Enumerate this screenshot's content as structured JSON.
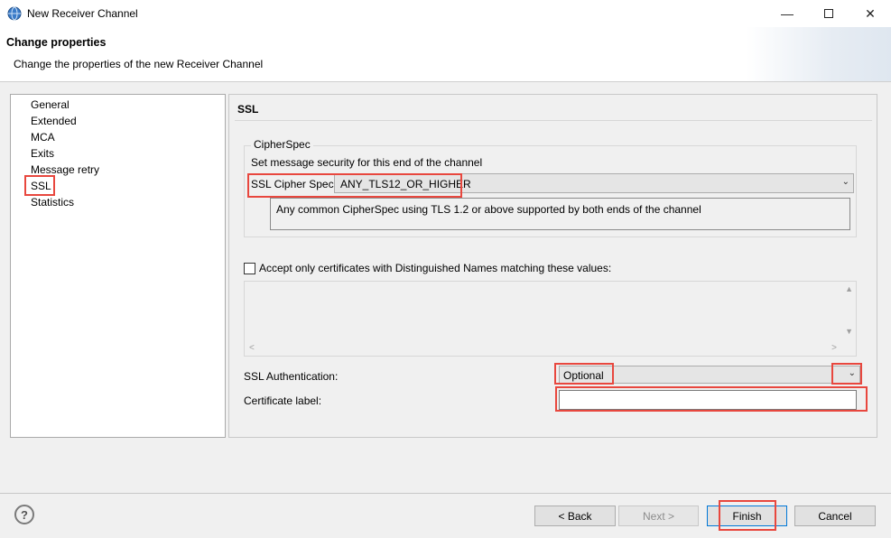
{
  "window": {
    "title": "New Receiver Channel",
    "minimize_icon": "minimize-icon",
    "maximize_icon": "maximize-icon",
    "close_icon": "close-icon"
  },
  "header": {
    "title": "Change properties",
    "description": "Change the properties of the new Receiver Channel"
  },
  "nav": {
    "items": [
      {
        "label": "General"
      },
      {
        "label": "Extended"
      },
      {
        "label": "MCA"
      },
      {
        "label": "Exits"
      },
      {
        "label": "Message retry"
      },
      {
        "label": "SSL"
      },
      {
        "label": "Statistics"
      }
    ],
    "selected": "SSL"
  },
  "panel": {
    "title": "SSL",
    "cipherspec": {
      "legend": "CipherSpec",
      "description": "Set message security for this end of the channel",
      "label": "SSL Cipher Spec:",
      "value": "ANY_TLS12_OR_HIGHER",
      "detail": "Any common CipherSpec using TLS 1.2 or above supported by both ends of the channel"
    },
    "dn_filter": {
      "label": "Accept only certificates with Distinguished Names matching these values:",
      "checked": false
    },
    "ssl_auth": {
      "label": "SSL Authentication:",
      "value": "Optional"
    },
    "cert_label": {
      "label": "Certificate label:",
      "value": ""
    }
  },
  "buttons": {
    "help": "?",
    "back": "< Back",
    "next": "Next >",
    "finish": "Finish",
    "cancel": "Cancel"
  },
  "colors": {
    "highlight": "#e8473e",
    "focus": "#0078d7"
  }
}
